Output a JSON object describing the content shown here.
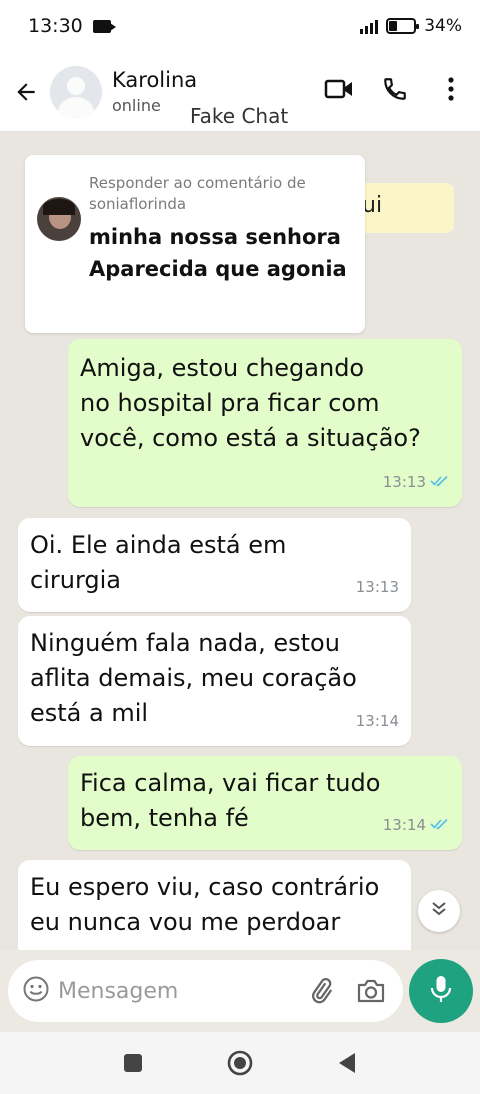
{
  "status_bar": {
    "time": "13:30",
    "battery": "34%",
    "battery_level": 0.34
  },
  "header": {
    "contact_name": "Karolina",
    "status": "online",
    "overlay_label": "Fake Chat"
  },
  "reply_card": {
    "hint": "Responder ao comentário de soniaflorinda",
    "text": "minha nossa senhora Aparecida que agonia",
    "behind_fragment": "ui"
  },
  "messages": [
    {
      "direction": "out",
      "lines": [
        "Amiga, estou chegando",
        "no hospital pra ficar com",
        "você, como está a situação?"
      ],
      "time": "13:13",
      "read": true
    },
    {
      "direction": "in",
      "lines": [
        "Oi. Ele ainda está em",
        "cirurgia"
      ],
      "time": "13:13"
    },
    {
      "direction": "in",
      "lines": [
        "Ninguém fala nada, estou",
        "aflita demais, meu coração",
        "está a mil"
      ],
      "time": "13:14"
    },
    {
      "direction": "out",
      "lines": [
        "Fica calma, vai ficar tudo",
        "bem, tenha fé"
      ],
      "time": "13:14",
      "read": true
    },
    {
      "direction": "in",
      "lines": [
        "Eu espero viu, caso contrário",
        "eu nunca vou me perdoar"
      ],
      "time": ""
    }
  ],
  "composer": {
    "placeholder": "Mensagem"
  },
  "colors": {
    "accent": "#1ea280",
    "outgoing_bubble": "#e2fdc9",
    "read_ticks": "#53bdeb",
    "chat_background": "#e9e6df"
  },
  "icons": [
    "back-arrow-icon",
    "video-call-icon",
    "phone-icon",
    "more-vert-icon",
    "emoji-icon",
    "attach-icon",
    "camera-icon",
    "mic-icon",
    "chevron-double-down-icon",
    "nav-recents-icon",
    "nav-home-icon",
    "nav-back-icon"
  ]
}
